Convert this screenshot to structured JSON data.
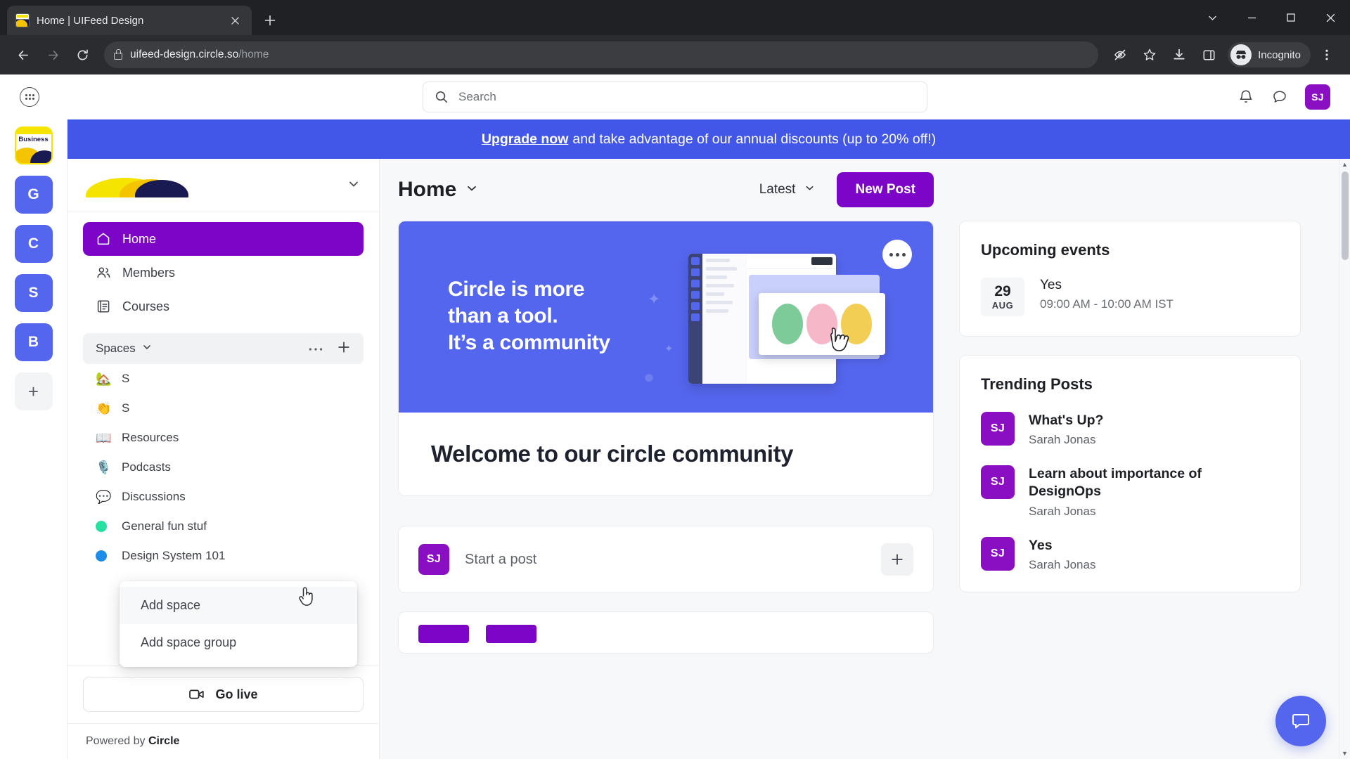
{
  "browser": {
    "tab": {
      "title": "Home | UIFeed Design",
      "favicon_label": "Business",
      "close_icon": "close-icon"
    },
    "new_tab_label": "+",
    "window_controls": {
      "minimize": "⌄",
      "restore_down": "—",
      "maximize": "❐",
      "close": "✕"
    },
    "nav": {
      "back": "←",
      "forward": "→",
      "reload": "⟳"
    },
    "omnibox": {
      "domain": "uifeed-design.circle.so",
      "path": "/home",
      "lock_icon": "lock-icon"
    },
    "actions": {
      "tracking_protection": "eye-off-icon",
      "bookmark": "star-icon",
      "downloads": "download-icon",
      "side_panel": "side-panel-icon",
      "profile_label": "Incognito",
      "menu": "kebab-menu-icon"
    }
  },
  "app": {
    "header": {
      "apps_icon": "apps-grid-icon",
      "search_placeholder": "Search",
      "notifications_icon": "bell-icon",
      "messages_icon": "chat-icon",
      "avatar_initials": "SJ"
    },
    "banner": {
      "link_text": "Upgrade now",
      "text": "and take advantage of our annual discounts (up to 20% off!)"
    },
    "rail": [
      {
        "name": "brand-workspace",
        "label": "Business",
        "type": "brand"
      },
      {
        "name": "workspace-g",
        "label": "G",
        "type": "letter"
      },
      {
        "name": "workspace-c",
        "label": "C",
        "type": "letter"
      },
      {
        "name": "workspace-s",
        "label": "S",
        "type": "letter"
      },
      {
        "name": "workspace-b",
        "label": "B",
        "type": "letter"
      },
      {
        "name": "add-workspace",
        "label": "+",
        "type": "add"
      }
    ],
    "sidebar": {
      "community_chevron": "chevron-down-icon",
      "nav": [
        {
          "label": "Home",
          "icon": "home-icon",
          "active": true
        },
        {
          "label": "Members",
          "icon": "members-icon",
          "active": false
        },
        {
          "label": "Courses",
          "icon": "courses-icon",
          "active": false
        }
      ],
      "spaces_header": {
        "label": "Spaces",
        "chevron": "chevron-down-icon",
        "more": "ellipsis-icon",
        "add": "plus-icon"
      },
      "spaces": [
        {
          "label": "S",
          "emoji": "🏡",
          "type": "emoji"
        },
        {
          "label": "S",
          "emoji": "👏",
          "type": "emoji"
        },
        {
          "label": "Resources",
          "emoji": "📖",
          "type": "emoji"
        },
        {
          "label": "Podcasts",
          "emoji": "🎙️",
          "type": "emoji"
        },
        {
          "label": "Discussions",
          "emoji": "💬",
          "type": "emoji"
        },
        {
          "label": "General fun stuf",
          "color": "#25e0a0",
          "type": "dot"
        },
        {
          "label": "Design System 101",
          "color": "#1c8ce8",
          "type": "dot"
        }
      ],
      "go_live": {
        "label": "Go live",
        "icon": "video-camera-icon"
      },
      "footer": {
        "prefix": "Powered by ",
        "brand": "Circle"
      }
    },
    "context_menu": {
      "items": [
        {
          "label": "Add space",
          "highlighted": true
        },
        {
          "label": "Add space group",
          "highlighted": false
        }
      ]
    },
    "main": {
      "title": "Home",
      "title_chevron": "chevron-down-icon",
      "sort": {
        "label": "Latest",
        "chevron": "chevron-down-icon"
      },
      "new_post_label": "New Post",
      "hero": {
        "line1": "Circle is more",
        "line2": "than a tool.",
        "line3": "It’s a community",
        "more_icon": "ellipsis-icon"
      },
      "welcome_text": "Welcome to our circle community",
      "composer": {
        "avatar_initials": "SJ",
        "placeholder": "Start a post",
        "add_icon": "plus-icon"
      }
    },
    "right": {
      "events": {
        "title": "Upcoming events",
        "items": [
          {
            "day": "29",
            "month": "AUG",
            "name": "Yes",
            "time": "09:00 AM - 10:00 AM IST"
          }
        ]
      },
      "trending": {
        "title": "Trending Posts",
        "items": [
          {
            "avatar": "SJ",
            "title": "What's Up?",
            "author": "Sarah Jonas"
          },
          {
            "avatar": "SJ",
            "title": "Learn about importance of DesignOps",
            "author": "Sarah Jonas"
          },
          {
            "avatar": "SJ",
            "title": "Yes",
            "author": "Sarah Jonas"
          }
        ]
      }
    },
    "chat_button_icon": "chat-bubble-icon",
    "colors": {
      "brand_purple": "#7d05c7",
      "accent_blue": "#5566ee",
      "banner_blue": "#4257e8",
      "avatar_purple": "#8a0fc2"
    }
  }
}
